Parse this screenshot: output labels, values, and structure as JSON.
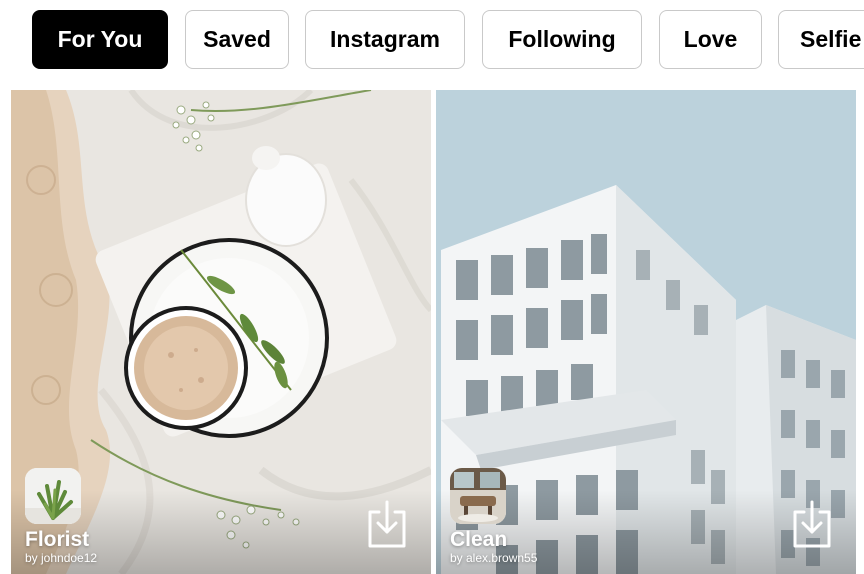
{
  "filters": {
    "items": [
      {
        "label": "For You",
        "active": true
      },
      {
        "label": "Saved",
        "active": false
      },
      {
        "label": "Instagram",
        "active": false
      },
      {
        "label": "Following",
        "active": false
      },
      {
        "label": "Love",
        "active": false
      },
      {
        "label": "Selfie",
        "active": false
      }
    ]
  },
  "cards": [
    {
      "title": "Florist",
      "author": "by johndoe12",
      "avatar_icon": "plant-icon",
      "action_icon": "download-icon"
    },
    {
      "title": "Clean",
      "author": "by alex.brown55",
      "avatar_icon": "interior-icon",
      "action_icon": "download-icon"
    }
  ],
  "colors": {
    "active_chip": "#000000",
    "chip_border": "#c9c9c9",
    "text_on_image": "#ffffff",
    "sky": "#bcd2dc"
  }
}
